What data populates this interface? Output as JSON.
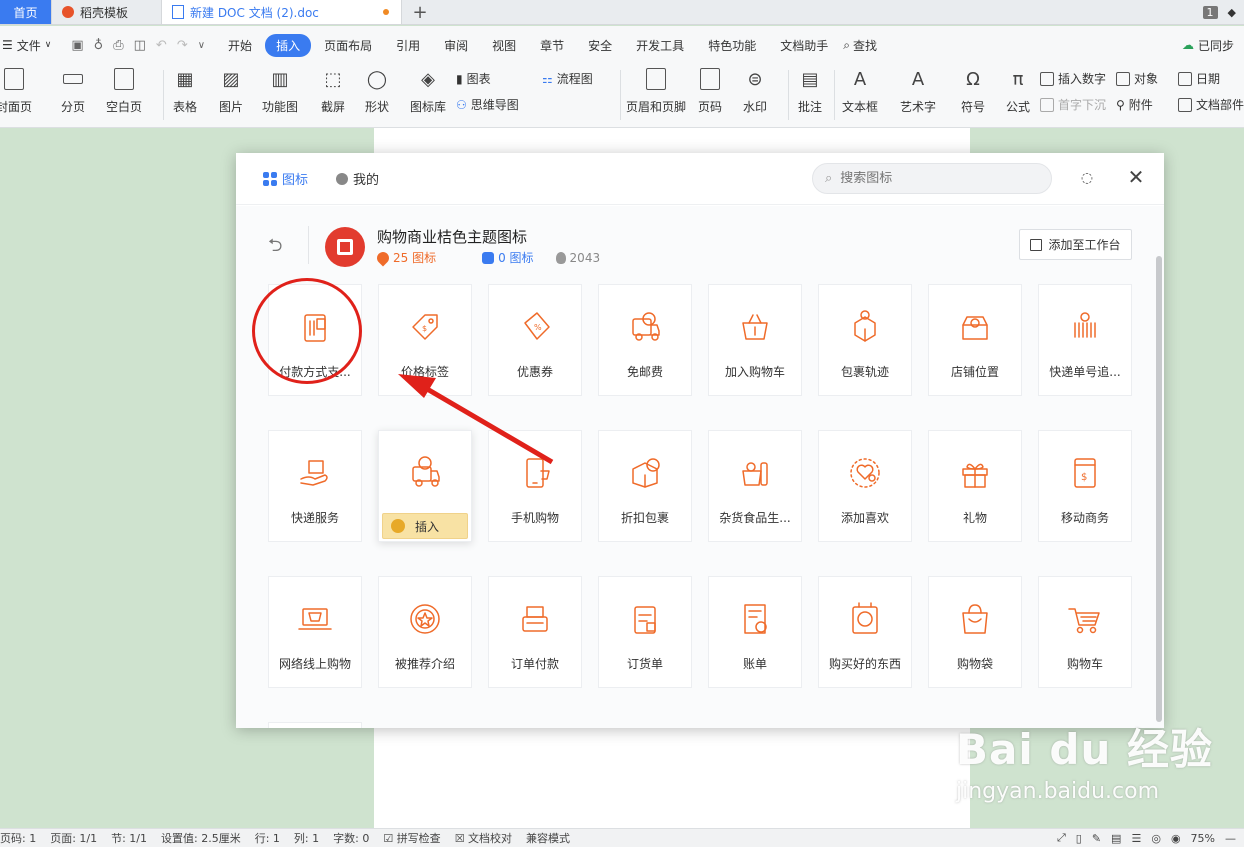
{
  "tabs": {
    "home": "首页",
    "template": "稻壳模板",
    "doc": "新建 DOC 文档 (2).doc",
    "page_badge": "1"
  },
  "menu": {
    "file": "文件",
    "items": [
      "开始",
      "插入",
      "页面布局",
      "引用",
      "审阅",
      "视图",
      "章节",
      "安全",
      "开发工具",
      "特色功能",
      "文档助手"
    ],
    "active": "插入",
    "search": "查找",
    "sync": "已同步"
  },
  "ribbon": {
    "cover": "封面页",
    "page_break": "分页",
    "blank_page": "空白页",
    "table": "表格",
    "picture": "图片",
    "function_chart": "功能图",
    "screenshot": "截屏",
    "shape": "形状",
    "icon_lib": "图标库",
    "chart": "图表",
    "mindmap": "思维导图",
    "flowchart": "流程图",
    "header_footer": "页眉和页脚",
    "page_num": "页码",
    "watermark": "水印",
    "comment": "批注",
    "textbox": "文本框",
    "wordart": "艺术字",
    "symbol": "符号",
    "formula": "公式",
    "insert_number": "插入数字",
    "drop_cap": "首字下沉",
    "object": "对象",
    "attachment": "附件",
    "date": "日期",
    "doc_parts": "文档部件"
  },
  "dialog": {
    "tab_icons": "图标",
    "tab_mine": "我的",
    "search_placeholder": "搜索图标",
    "pack_title": "购物商业桔色主题图标",
    "pack_count": "25 图标",
    "free_count": "0 图标",
    "hot_count": "2043",
    "add_workspace": "添加至工作台",
    "insert": "插入",
    "icons": [
      {
        "label": "付款方式支...",
        "icon": "payment-icon"
      },
      {
        "label": "价格标签",
        "icon": "price-tag-icon"
      },
      {
        "label": "优惠券",
        "icon": "coupon-icon"
      },
      {
        "label": "免邮费",
        "icon": "free-shipping-icon"
      },
      {
        "label": "加入购物车",
        "icon": "add-to-basket-icon"
      },
      {
        "label": "包裹轨迹",
        "icon": "package-tracking-icon"
      },
      {
        "label": "店铺位置",
        "icon": "store-location-icon"
      },
      {
        "label": "快递单号追...",
        "icon": "tracking-number-icon"
      },
      {
        "label": "快递服务",
        "icon": "delivery-service-icon"
      },
      {
        "label": "",
        "icon": "delivery-truck-icon"
      },
      {
        "label": "手机购物",
        "icon": "mobile-shopping-icon"
      },
      {
        "label": "折扣包裹",
        "icon": "discount-package-icon"
      },
      {
        "label": "杂货食品生...",
        "icon": "grocery-icon"
      },
      {
        "label": "添加喜欢",
        "icon": "add-favorite-icon"
      },
      {
        "label": "礼物",
        "icon": "gift-icon"
      },
      {
        "label": "移动商务",
        "icon": "mobile-commerce-icon"
      },
      {
        "label": "网络线上购物",
        "icon": "online-shopping-icon"
      },
      {
        "label": "被推荐介绍",
        "icon": "recommended-icon"
      },
      {
        "label": "订单付款",
        "icon": "order-payment-icon"
      },
      {
        "label": "订货单",
        "icon": "order-form-icon"
      },
      {
        "label": "账单",
        "icon": "bill-icon"
      },
      {
        "label": "购买好的东西",
        "icon": "purchase-icon"
      },
      {
        "label": "购物袋",
        "icon": "shopping-bag-icon"
      },
      {
        "label": "购物车",
        "icon": "shopping-cart-icon"
      },
      {
        "label": "",
        "icon": "storefront-icon"
      }
    ]
  },
  "status": {
    "page_code": "页码: 1",
    "page": "页面: 1/1",
    "section": "节: 1/1",
    "setting": "设置值: 2.5厘米",
    "line": "行: 1",
    "col": "列: 1",
    "words": "字数: 0",
    "spell": "拼写检查",
    "proof": "文档校对",
    "compat": "兼容模式",
    "zoom": "75%"
  },
  "watermark": {
    "main": "Bai du 经验",
    "sub": "jingyan.baidu.com"
  },
  "colors": {
    "accent": "#3a7bf0",
    "icon_orange": "#ef6b2a",
    "annotation_red": "#e0211a"
  }
}
